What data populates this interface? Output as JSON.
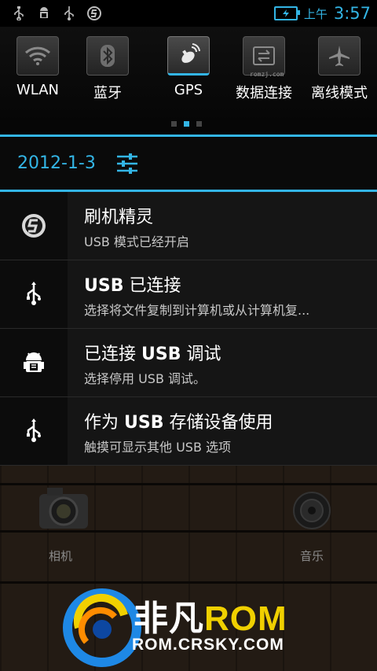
{
  "status_bar": {
    "icons": [
      "usb-icon",
      "android-debug-icon",
      "usb-icon",
      "flash-app-icon"
    ],
    "ampm": "上午",
    "time": "3:57"
  },
  "quick_toggles": [
    {
      "label": "WLAN",
      "icon": "wifi-icon",
      "active": false
    },
    {
      "label": "蓝牙",
      "icon": "bluetooth-icon",
      "active": false
    },
    {
      "label": "GPS",
      "icon": "gps-icon",
      "active": true
    },
    {
      "label": "数据连接",
      "icon": "data-connection-icon",
      "active": false
    },
    {
      "label": "离线模式",
      "icon": "airplane-icon",
      "active": false
    }
  ],
  "watermark": "romzj.com",
  "page_dots": 3,
  "page_dot_active": 2,
  "date": "2012-1-3",
  "notifications": [
    {
      "icon": "flash-app-icon",
      "title": "刷机精灵",
      "text": "USB 模式已经开启"
    },
    {
      "icon": "usb-icon",
      "title": "USB 已连接",
      "text": "选择将文件复制到计算机或从计算机复..."
    },
    {
      "icon": "android-debug-icon",
      "title": "已连接 USB 调试",
      "text": "选择停用 USB 调试。"
    },
    {
      "icon": "usb-icon",
      "title": "作为 USB 存储设备使用",
      "text": "触摸可显示其他 USB 选项"
    }
  ],
  "home_apps": {
    "camera": "相机",
    "music": "音乐"
  },
  "logo": {
    "title_cn": "非凡",
    "title_rom": "ROM",
    "url": "ROM.CRSKY.COM"
  },
  "colors": {
    "accent": "#33b5e5",
    "logo_yellow": "#f0d000"
  }
}
